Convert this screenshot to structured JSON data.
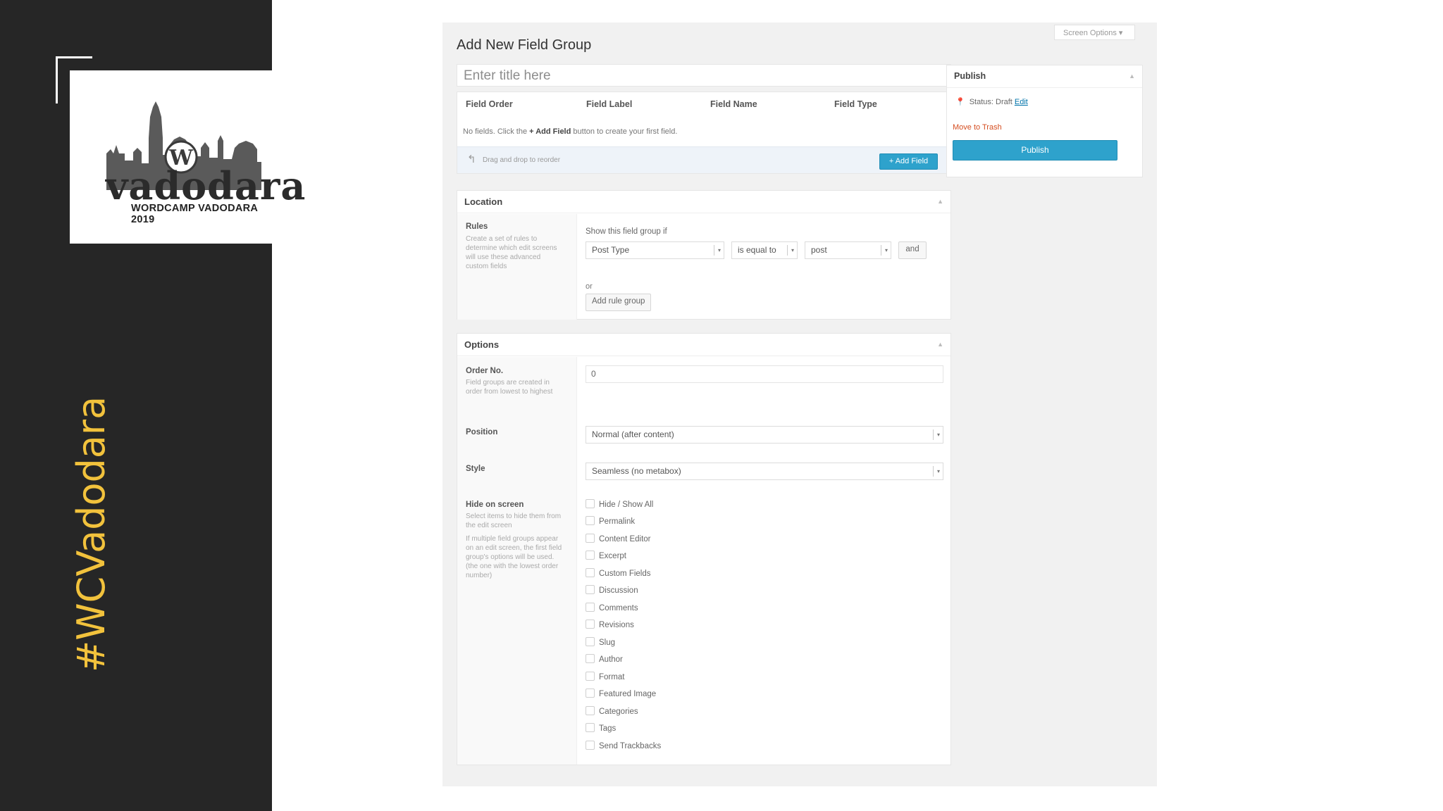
{
  "sidebar": {
    "logo_word": "vadodara",
    "logo_subtitle": "WORDCAMP VADODARA 2019",
    "hashtag": "#WCVadodara"
  },
  "colors": {
    "sidebar_bg": "#262626",
    "hashtag": "#f2c23c",
    "primary_button": "#2ea2cc",
    "trash_link": "#d54e21"
  },
  "screen_options": "Screen Options",
  "page_title": "Add New Field Group",
  "title_input": {
    "placeholder": "Enter title here",
    "value": ""
  },
  "fields": {
    "columns": [
      "Field Order",
      "Field Label",
      "Field Name",
      "Field Type"
    ],
    "empty_prefix": "No fields. Click the",
    "empty_button_ref": "+ Add Field",
    "empty_suffix": "button to create your first field.",
    "drag_hint": "Drag and drop to reorder",
    "add_field_button": "+ Add Field"
  },
  "location": {
    "title": "Location",
    "rules_label": "Rules",
    "rules_desc": "Create a set of rules to determine which edit screens will use these advanced custom fields",
    "show_if": "Show this field group if",
    "param": "Post Type",
    "operator": "is equal to",
    "value": "post",
    "and_button": "and",
    "or_label": "or",
    "add_rule_group": "Add rule group"
  },
  "options": {
    "title": "Options",
    "order_label": "Order No.",
    "order_desc": "Field groups are created in order from lowest to highest",
    "order_value": "0",
    "position_label": "Position",
    "position_value": "Normal (after content)",
    "style_label": "Style",
    "style_value": "Seamless (no metabox)",
    "hide_label": "Hide on screen",
    "hide_desc_1": "Select items to hide them from the edit screen",
    "hide_desc_2": "If multiple field groups appear on an edit screen, the first field group's options will be used. (the one with the lowest order number)",
    "hide_items": [
      "Hide / Show All",
      "Permalink",
      "Content Editor",
      "Excerpt",
      "Custom Fields",
      "Discussion",
      "Comments",
      "Revisions",
      "Slug",
      "Author",
      "Format",
      "Featured Image",
      "Categories",
      "Tags",
      "Send Trackbacks"
    ]
  },
  "publish": {
    "title": "Publish",
    "status_label": "Status:",
    "status_value": "Draft",
    "status_edit": "Edit",
    "move_to_trash": "Move to Trash",
    "publish_button": "Publish"
  }
}
